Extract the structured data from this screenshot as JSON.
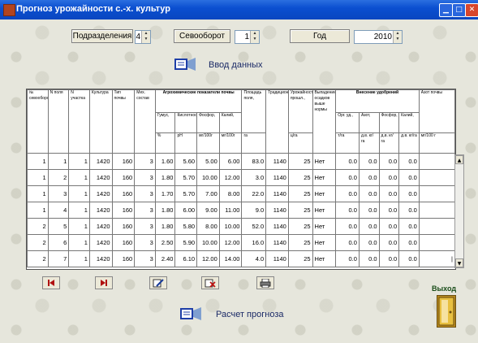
{
  "window": {
    "title": "Прогноз урожайности с.-х. культур"
  },
  "toolbar": {
    "subdivisions_label": "Подразделения",
    "subdivisions_value": "4",
    "rotation_label": "Севооборот",
    "rotation_value": "1",
    "year_label": "Год",
    "year_value": "2010"
  },
  "sections": {
    "input_data": "Ввод данных",
    "forecast": "Расчет прогноза"
  },
  "grid": {
    "headers": {
      "rotation_no": "№ севооборота",
      "field_no": "N поля",
      "plot_no": "N участка",
      "crop": "Культура",
      "soil_type": "Тип почвы",
      "mech_comp": "Мех. состав",
      "agro_group": "Агрохимические показатели почвы",
      "humus": "Гумус,",
      "acidity": "Кислотность,",
      "phosphorus": "Фосфор,",
      "potassium": "Калий,",
      "humus_unit": "%",
      "acidity_unit": "pH",
      "phosphorus_unit": "мг/100г",
      "potassium_unit": "мг/100г",
      "area": "Площадь поля,",
      "area_unit": "га",
      "tradition": "Традиционная",
      "yield": "Урожайность прошл.,",
      "yield_unit": "ц/га",
      "above_norm": "Выпадение осадков выше нормы",
      "fert_group": "Внесение удобрений",
      "organic": "Орг. уд.,",
      "nitrogen": "Азот,",
      "phos_fert": "Фосфор,",
      "pot_fert": "Калий,",
      "fert_unit1": "т/га",
      "fert_unit2": "д.в. кг/га",
      "fert_unit3": "д.в. кг/га",
      "fert_unit4": "д.в. кг/га",
      "nitrogen_soil": "Азот почвы",
      "nitrogen_soil_unit": "мг/100 г"
    },
    "rows": [
      [
        "1",
        "1",
        "1",
        "1420",
        "160",
        "3",
        "1.60",
        "5.60",
        "5.00",
        "6.00",
        "83.0",
        "1140",
        "25",
        "Нет",
        "0.0",
        "0.0",
        "0.0",
        "0.0",
        ""
      ],
      [
        "1",
        "2",
        "1",
        "1420",
        "160",
        "3",
        "1.80",
        "5.70",
        "10.00",
        "12.00",
        "3.0",
        "1140",
        "25",
        "Нет",
        "0.0",
        "0.0",
        "0.0",
        "0.0",
        ""
      ],
      [
        "1",
        "3",
        "1",
        "1420",
        "160",
        "3",
        "1.70",
        "5.70",
        "7.00",
        "8.00",
        "22.0",
        "1140",
        "25",
        "Нет",
        "0.0",
        "0.0",
        "0.0",
        "0.0",
        ""
      ],
      [
        "1",
        "4",
        "1",
        "1420",
        "160",
        "3",
        "1.80",
        "6.00",
        "9.00",
        "11.00",
        "9.0",
        "1140",
        "25",
        "Нет",
        "0.0",
        "0.0",
        "0.0",
        "0.0",
        ""
      ],
      [
        "2",
        "5",
        "1",
        "1420",
        "160",
        "3",
        "1.80",
        "5.80",
        "8.00",
        "10.00",
        "52.0",
        "1140",
        "25",
        "Нет",
        "0.0",
        "0.0",
        "0.0",
        "0.0",
        ""
      ],
      [
        "2",
        "6",
        "1",
        "1420",
        "160",
        "3",
        "2.50",
        "5.90",
        "10.00",
        "12.00",
        "16.0",
        "1140",
        "25",
        "Нет",
        "0.0",
        "0.0",
        "0.0",
        "0.0",
        ""
      ],
      [
        "2",
        "7",
        "1",
        "1420",
        "160",
        "3",
        "2.40",
        "6.10",
        "12.00",
        "14.00",
        "4.0",
        "1140",
        "25",
        "Нет",
        "0.0",
        "0.0",
        "0.0",
        "0.0",
        "|"
      ]
    ]
  },
  "exit": {
    "label": "Выход"
  },
  "colors": {
    "titlebar": "#0b4fd0",
    "label_text": "#1b2a66"
  }
}
